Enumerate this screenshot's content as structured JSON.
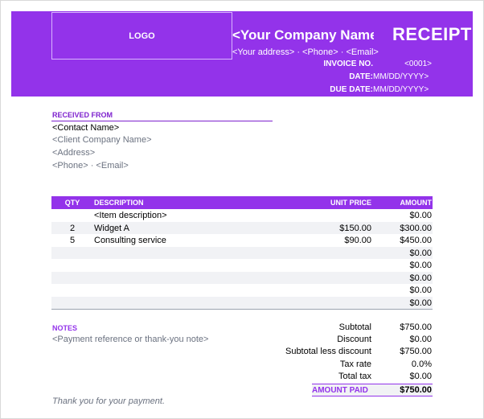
{
  "header": {
    "logo_text": "LOGO",
    "company_name": "<Your Company Name>",
    "receipt_title": "RECEIPT",
    "contact_line": "<Your address>  ·  <Phone>  ·  <Email>",
    "invoice_no_label": "INVOICE NO.",
    "invoice_no_value": "<0001>",
    "date_label": "DATE:",
    "date_value": "MM/DD/YYYY>",
    "due_date_label": "DUE DATE:",
    "due_date_value": "MM/DD/YYYY>"
  },
  "received_from": {
    "title": "RECEIVED FROM",
    "contact_name": "<Contact Name>",
    "client_company": "<Client Company Name>",
    "address": "<Address>",
    "phone_email": "<Phone>  ·  <Email>"
  },
  "table": {
    "headers": {
      "qty": "QTY",
      "description": "DESCRIPTION",
      "unit_price": "UNIT PRICE",
      "amount": "AMOUNT"
    },
    "rows": [
      {
        "qty": "",
        "description": "<Item description>",
        "unit_price": "",
        "amount": "$0.00"
      },
      {
        "qty": "2",
        "description": "Widget A",
        "unit_price": "$150.00",
        "amount": "$300.00"
      },
      {
        "qty": "5",
        "description": "Consulting service",
        "unit_price": "$90.00",
        "amount": "$450.00"
      },
      {
        "qty": "",
        "description": "",
        "unit_price": "",
        "amount": "$0.00"
      },
      {
        "qty": "",
        "description": "",
        "unit_price": "",
        "amount": "$0.00"
      },
      {
        "qty": "",
        "description": "",
        "unit_price": "",
        "amount": "$0.00"
      },
      {
        "qty": "",
        "description": "",
        "unit_price": "",
        "amount": "$0.00"
      },
      {
        "qty": "",
        "description": "",
        "unit_price": "",
        "amount": "$0.00"
      }
    ]
  },
  "notes": {
    "title": "NOTES",
    "text": "<Payment reference or thank-you note>"
  },
  "totals": {
    "subtotal_label": "Subtotal",
    "subtotal_value": "$750.00",
    "discount_label": "Discount",
    "discount_value": "$0.00",
    "subtotal_less_label": "Subtotal less discount",
    "subtotal_less_value": "$750.00",
    "tax_rate_label": "Tax rate",
    "tax_rate_value": "0.0%",
    "total_tax_label": "Total tax",
    "total_tax_value": "$0.00",
    "amount_paid_label": "AMOUNT PAID",
    "amount_paid_value": "$750.00"
  },
  "footer": {
    "thanks": "Thank you for your payment."
  },
  "colors": {
    "accent": "#9333ea",
    "accent_dark": "#7e22ce",
    "row_alt": "#f1f2f5",
    "muted_text": "#6b7280"
  }
}
